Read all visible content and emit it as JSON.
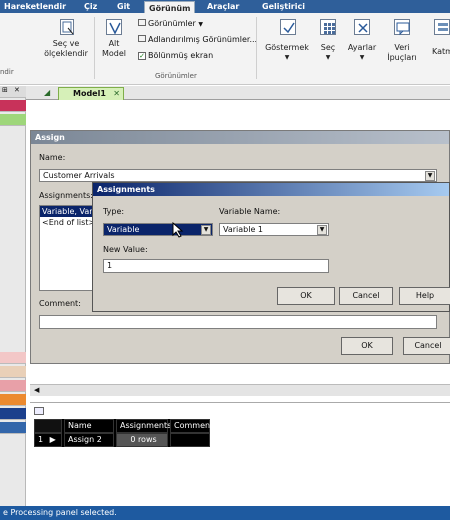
{
  "ribbon_tabs": [
    "Hareketlendir",
    "Çiz",
    "Git",
    "Görünüm",
    "Araçlar",
    "Geliştirici"
  ],
  "ribbon": {
    "scale_button": [
      "Seç ve",
      "ölçeklendir"
    ],
    "submodel_button": [
      "Alt",
      "Model"
    ],
    "views_menu": "Görünümler",
    "named_views": "Adlandırılmış Görünümler...",
    "split_screen": "Bölünmüş ekran",
    "views_group": "Görünümler",
    "left_label": "ndir",
    "show_button": "Göstermek",
    "select_button": "Seç",
    "settings_button": "Ayarlar",
    "data_tips_button": [
      "Veri",
      "İpuçları"
    ],
    "layers_button": "Katm"
  },
  "model_tab": "Model1",
  "assign_dialog": {
    "title": "Assign",
    "name_label": "Name:",
    "name_value": "Customer Arrivals",
    "assignments_label": "Assignments:",
    "list_items": [
      "Variable, Vari",
      "<End of list>"
    ],
    "comment_label": "Comment:",
    "comment_value": "",
    "ok": "OK",
    "cancel": "Cancel"
  },
  "assignments_dialog": {
    "title": "Assignments",
    "type_label": "Type:",
    "type_value": "Variable",
    "variable_name_label": "Variable Name:",
    "variable_name_value": "Variable 1",
    "new_value_label": "New Value:",
    "new_value": "1",
    "ok": "OK",
    "cancel": "Cancel",
    "help": "Help"
  },
  "grid": {
    "headers": [
      "Name",
      "Assignments",
      "Comment"
    ],
    "rows": [
      [
        "Assign 2",
        "0 rows",
        ""
      ]
    ],
    "row_number": "1"
  },
  "status": "e Processing panel selected.",
  "colors": {
    "title_gradient_start": "#0a246a",
    "title_gradient_end": "#a6caf0",
    "ribbon_tab_bg": "#2f5f9a",
    "status_bg": "#1e5aa0",
    "model_tab": "#d6f0b8"
  }
}
